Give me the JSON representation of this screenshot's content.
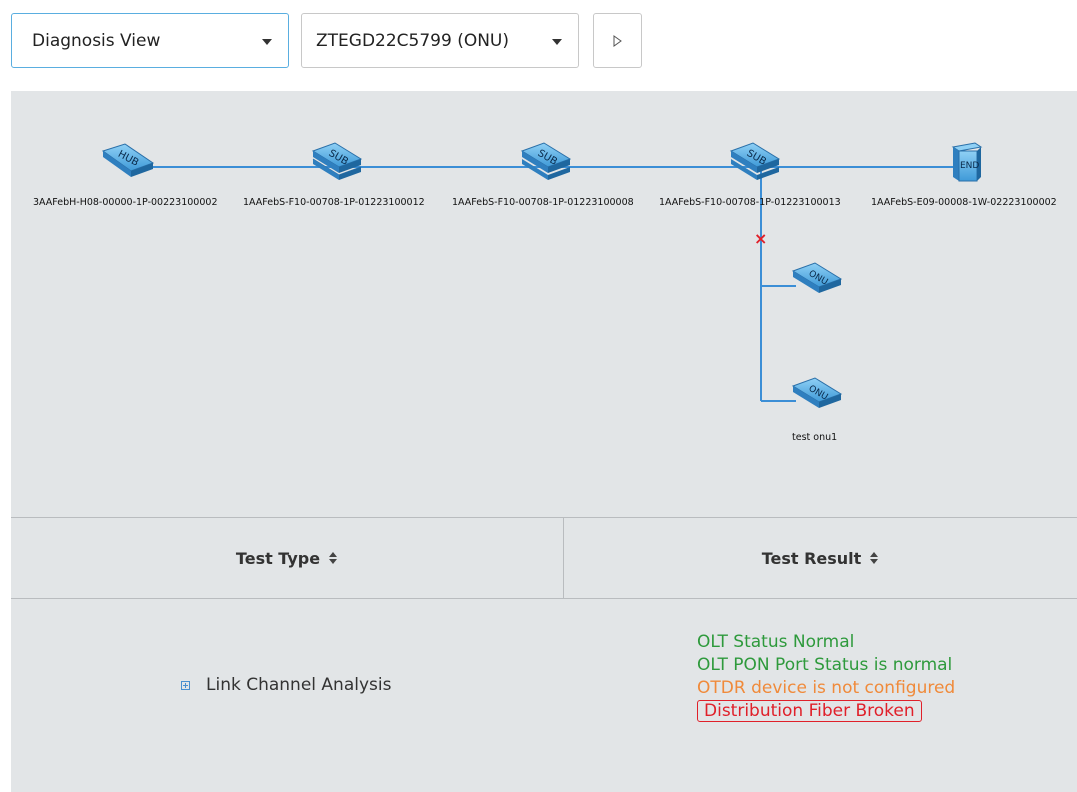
{
  "toolbar": {
    "view_select": {
      "value": "Diagnosis View"
    },
    "device_select": {
      "value": "ZTEGD22C5799 (ONU)"
    },
    "run_button_icon": "play-icon"
  },
  "topology": {
    "nodes": [
      {
        "id": "hub",
        "type_label": "HUB",
        "label": "3AAFebH-H08-00000-1P-00223100002"
      },
      {
        "id": "sub1",
        "type_label": "SUB",
        "label": "1AAFebS-F10-00708-1P-01223100012"
      },
      {
        "id": "sub2",
        "type_label": "SUB",
        "label": "1AAFebS-F10-00708-1P-01223100008"
      },
      {
        "id": "sub3",
        "type_label": "SUB",
        "label": "1AAFebS-F10-00708-1P-01223100013"
      },
      {
        "id": "end",
        "type_label": "END",
        "label": "1AAFebS-E09-00008-1W-02223100002"
      },
      {
        "id": "onu1",
        "type_label": "ONU",
        "label": ""
      },
      {
        "id": "onu2",
        "type_label": "ONU",
        "label": "test onu1"
      }
    ],
    "break_marker": "×",
    "colors": {
      "link": "#3b8ed6",
      "break": "#e0202a",
      "device": "#4aa3df"
    }
  },
  "table": {
    "headers": {
      "type": "Test Type",
      "result": "Test Result"
    },
    "rows": [
      {
        "type": "Link Channel Analysis",
        "results": {
          "olt_status": "OLT Status Normal",
          "pon_port": "OLT PON Port Status is normal",
          "otdr": "OTDR device is not configured",
          "fiber": "Distribution Fiber Broken"
        }
      }
    ]
  },
  "status_colors": {
    "normal": "#2e9a3c",
    "warning": "#f08a3a",
    "error": "#e0202a"
  }
}
